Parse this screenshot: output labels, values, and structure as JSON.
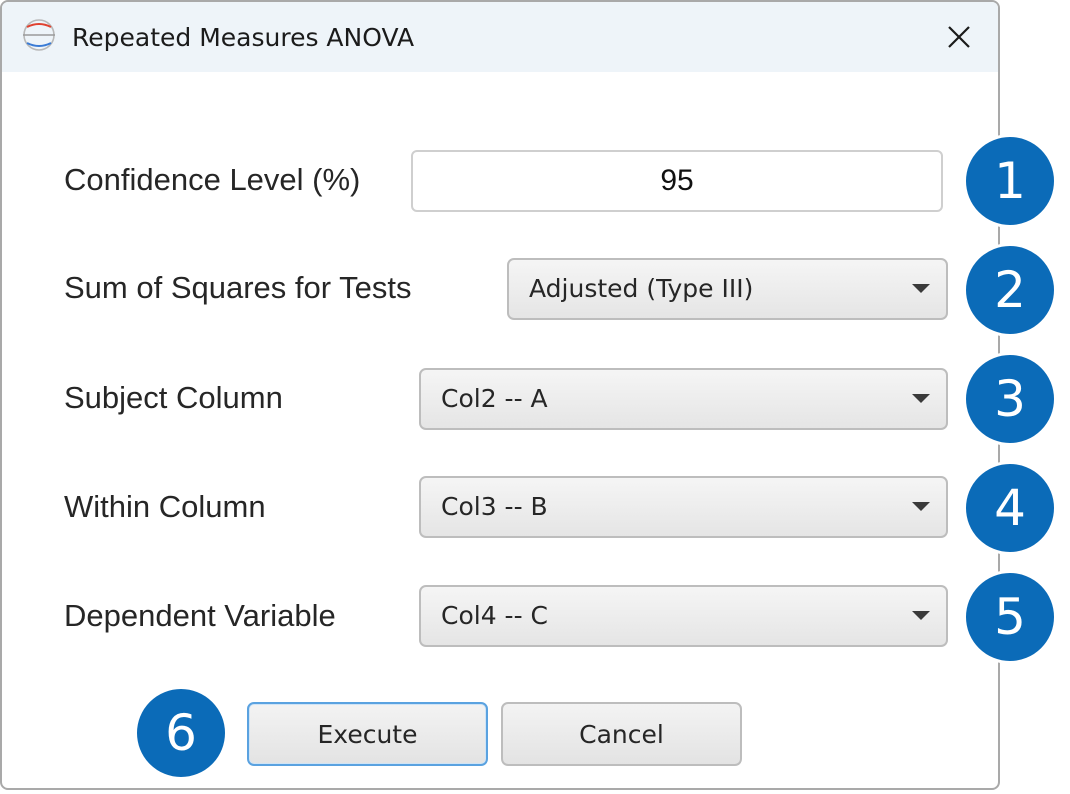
{
  "window": {
    "title": "Repeated Measures ANOVA",
    "icon": "anova-app-icon",
    "close_icon": "close-icon"
  },
  "form": {
    "confidence_level": {
      "label": "Confidence Level (%)",
      "value": "95"
    },
    "sum_of_squares": {
      "label": "Sum of Squares for Tests",
      "selected": "Adjusted (Type III)"
    },
    "subject_column": {
      "label": "Subject Column",
      "selected": "Col2 -- A"
    },
    "within_column": {
      "label": "Within Column",
      "selected": "Col3 -- B"
    },
    "dependent_variable": {
      "label": "Dependent Variable",
      "selected": "Col4 -- C"
    }
  },
  "buttons": {
    "execute_label": "Execute",
    "cancel_label": "Cancel"
  },
  "callouts": [
    "1",
    "2",
    "3",
    "4",
    "5",
    "6"
  ],
  "colors": {
    "callout_fill": "#0b6bb8",
    "titlebar": "#eef4f9",
    "focus_border": "#5aa2e0"
  }
}
